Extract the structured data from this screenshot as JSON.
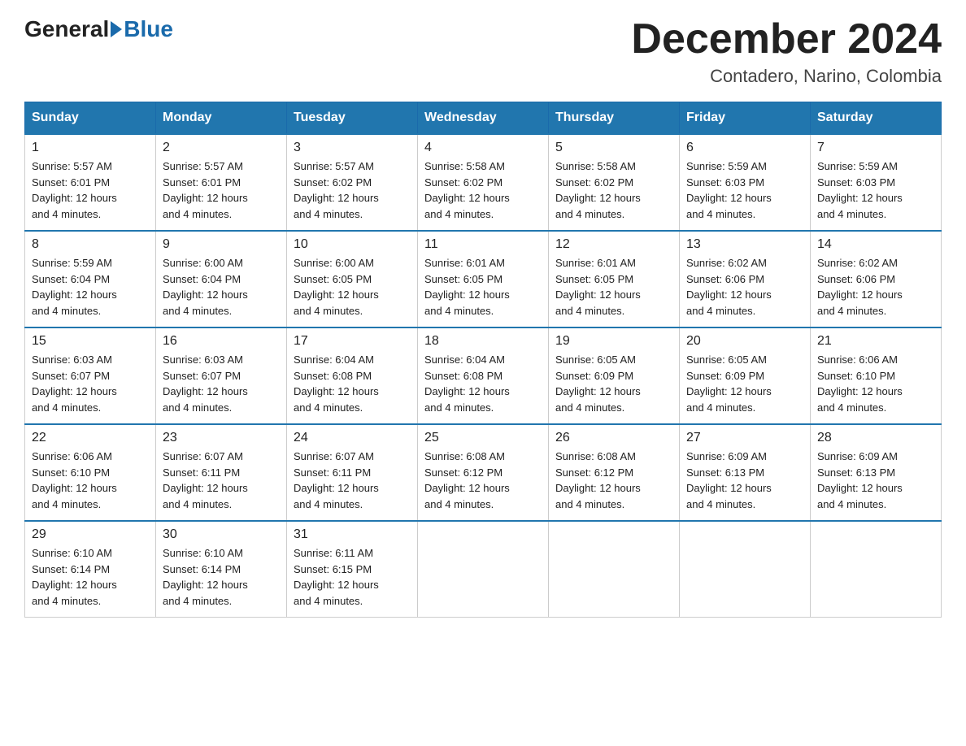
{
  "header": {
    "logo_general": "General",
    "logo_blue": "Blue",
    "month_title": "December 2024",
    "subtitle": "Contadero, Narino, Colombia"
  },
  "days_of_week": [
    "Sunday",
    "Monday",
    "Tuesday",
    "Wednesday",
    "Thursday",
    "Friday",
    "Saturday"
  ],
  "weeks": [
    [
      {
        "day": "1",
        "sunrise": "5:57 AM",
        "sunset": "6:01 PM",
        "daylight": "12 hours and 4 minutes."
      },
      {
        "day": "2",
        "sunrise": "5:57 AM",
        "sunset": "6:01 PM",
        "daylight": "12 hours and 4 minutes."
      },
      {
        "day": "3",
        "sunrise": "5:57 AM",
        "sunset": "6:02 PM",
        "daylight": "12 hours and 4 minutes."
      },
      {
        "day": "4",
        "sunrise": "5:58 AM",
        "sunset": "6:02 PM",
        "daylight": "12 hours and 4 minutes."
      },
      {
        "day": "5",
        "sunrise": "5:58 AM",
        "sunset": "6:02 PM",
        "daylight": "12 hours and 4 minutes."
      },
      {
        "day": "6",
        "sunrise": "5:59 AM",
        "sunset": "6:03 PM",
        "daylight": "12 hours and 4 minutes."
      },
      {
        "day": "7",
        "sunrise": "5:59 AM",
        "sunset": "6:03 PM",
        "daylight": "12 hours and 4 minutes."
      }
    ],
    [
      {
        "day": "8",
        "sunrise": "5:59 AM",
        "sunset": "6:04 PM",
        "daylight": "12 hours and 4 minutes."
      },
      {
        "day": "9",
        "sunrise": "6:00 AM",
        "sunset": "6:04 PM",
        "daylight": "12 hours and 4 minutes."
      },
      {
        "day": "10",
        "sunrise": "6:00 AM",
        "sunset": "6:05 PM",
        "daylight": "12 hours and 4 minutes."
      },
      {
        "day": "11",
        "sunrise": "6:01 AM",
        "sunset": "6:05 PM",
        "daylight": "12 hours and 4 minutes."
      },
      {
        "day": "12",
        "sunrise": "6:01 AM",
        "sunset": "6:05 PM",
        "daylight": "12 hours and 4 minutes."
      },
      {
        "day": "13",
        "sunrise": "6:02 AM",
        "sunset": "6:06 PM",
        "daylight": "12 hours and 4 minutes."
      },
      {
        "day": "14",
        "sunrise": "6:02 AM",
        "sunset": "6:06 PM",
        "daylight": "12 hours and 4 minutes."
      }
    ],
    [
      {
        "day": "15",
        "sunrise": "6:03 AM",
        "sunset": "6:07 PM",
        "daylight": "12 hours and 4 minutes."
      },
      {
        "day": "16",
        "sunrise": "6:03 AM",
        "sunset": "6:07 PM",
        "daylight": "12 hours and 4 minutes."
      },
      {
        "day": "17",
        "sunrise": "6:04 AM",
        "sunset": "6:08 PM",
        "daylight": "12 hours and 4 minutes."
      },
      {
        "day": "18",
        "sunrise": "6:04 AM",
        "sunset": "6:08 PM",
        "daylight": "12 hours and 4 minutes."
      },
      {
        "day": "19",
        "sunrise": "6:05 AM",
        "sunset": "6:09 PM",
        "daylight": "12 hours and 4 minutes."
      },
      {
        "day": "20",
        "sunrise": "6:05 AM",
        "sunset": "6:09 PM",
        "daylight": "12 hours and 4 minutes."
      },
      {
        "day": "21",
        "sunrise": "6:06 AM",
        "sunset": "6:10 PM",
        "daylight": "12 hours and 4 minutes."
      }
    ],
    [
      {
        "day": "22",
        "sunrise": "6:06 AM",
        "sunset": "6:10 PM",
        "daylight": "12 hours and 4 minutes."
      },
      {
        "day": "23",
        "sunrise": "6:07 AM",
        "sunset": "6:11 PM",
        "daylight": "12 hours and 4 minutes."
      },
      {
        "day": "24",
        "sunrise": "6:07 AM",
        "sunset": "6:11 PM",
        "daylight": "12 hours and 4 minutes."
      },
      {
        "day": "25",
        "sunrise": "6:08 AM",
        "sunset": "6:12 PM",
        "daylight": "12 hours and 4 minutes."
      },
      {
        "day": "26",
        "sunrise": "6:08 AM",
        "sunset": "6:12 PM",
        "daylight": "12 hours and 4 minutes."
      },
      {
        "day": "27",
        "sunrise": "6:09 AM",
        "sunset": "6:13 PM",
        "daylight": "12 hours and 4 minutes."
      },
      {
        "day": "28",
        "sunrise": "6:09 AM",
        "sunset": "6:13 PM",
        "daylight": "12 hours and 4 minutes."
      }
    ],
    [
      {
        "day": "29",
        "sunrise": "6:10 AM",
        "sunset": "6:14 PM",
        "daylight": "12 hours and 4 minutes."
      },
      {
        "day": "30",
        "sunrise": "6:10 AM",
        "sunset": "6:14 PM",
        "daylight": "12 hours and 4 minutes."
      },
      {
        "day": "31",
        "sunrise": "6:11 AM",
        "sunset": "6:15 PM",
        "daylight": "12 hours and 4 minutes."
      },
      null,
      null,
      null,
      null
    ]
  ],
  "labels": {
    "sunrise": "Sunrise:",
    "sunset": "Sunset:",
    "daylight": "Daylight:"
  }
}
